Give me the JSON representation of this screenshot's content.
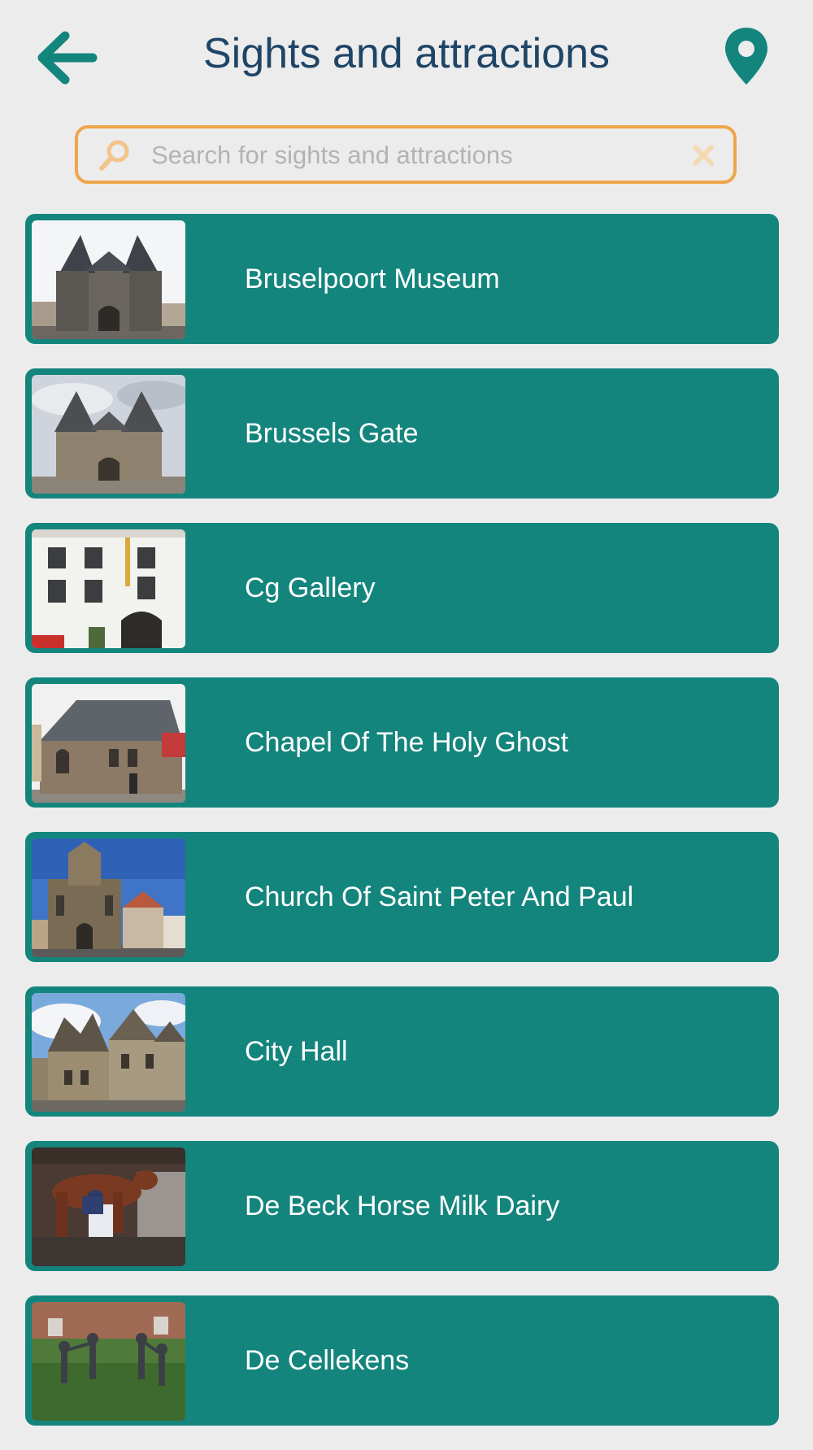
{
  "header": {
    "title": "Sights and attractions",
    "back_icon": "arrow-left-icon",
    "map_icon": "map-pin-icon"
  },
  "search": {
    "placeholder": "Search for sights and attractions",
    "value": "",
    "search_icon": "magnifier-icon",
    "clear_icon": "close-icon"
  },
  "colors": {
    "background": "#ececed",
    "title": "#1f4566",
    "accent": "#14857d",
    "search_border": "#eea64b"
  },
  "items": [
    {
      "label": "Bruselpoort Museum",
      "thumbnail": "photo of gothic gate tower with twin spires"
    },
    {
      "label": "Brussels Gate",
      "thumbnail": "photo of stone gate with twin towers"
    },
    {
      "label": "Cg Gallery",
      "thumbnail": "photo of white building facade with arched door"
    },
    {
      "label": "Chapel Of The Holy Ghost",
      "thumbnail": "photo of stone chapel with slate roof"
    },
    {
      "label": "Church Of Saint Peter And Paul",
      "thumbnail": "photo of baroque church facade"
    },
    {
      "label": "City Hall",
      "thumbnail": "photo of gothic city hall building"
    },
    {
      "label": "De Beck Horse Milk Dairy",
      "thumbnail": "photo of person milking a horse"
    },
    {
      "label": "De Cellekens",
      "thumbnail": "photo of bronze dancing children statues"
    }
  ]
}
